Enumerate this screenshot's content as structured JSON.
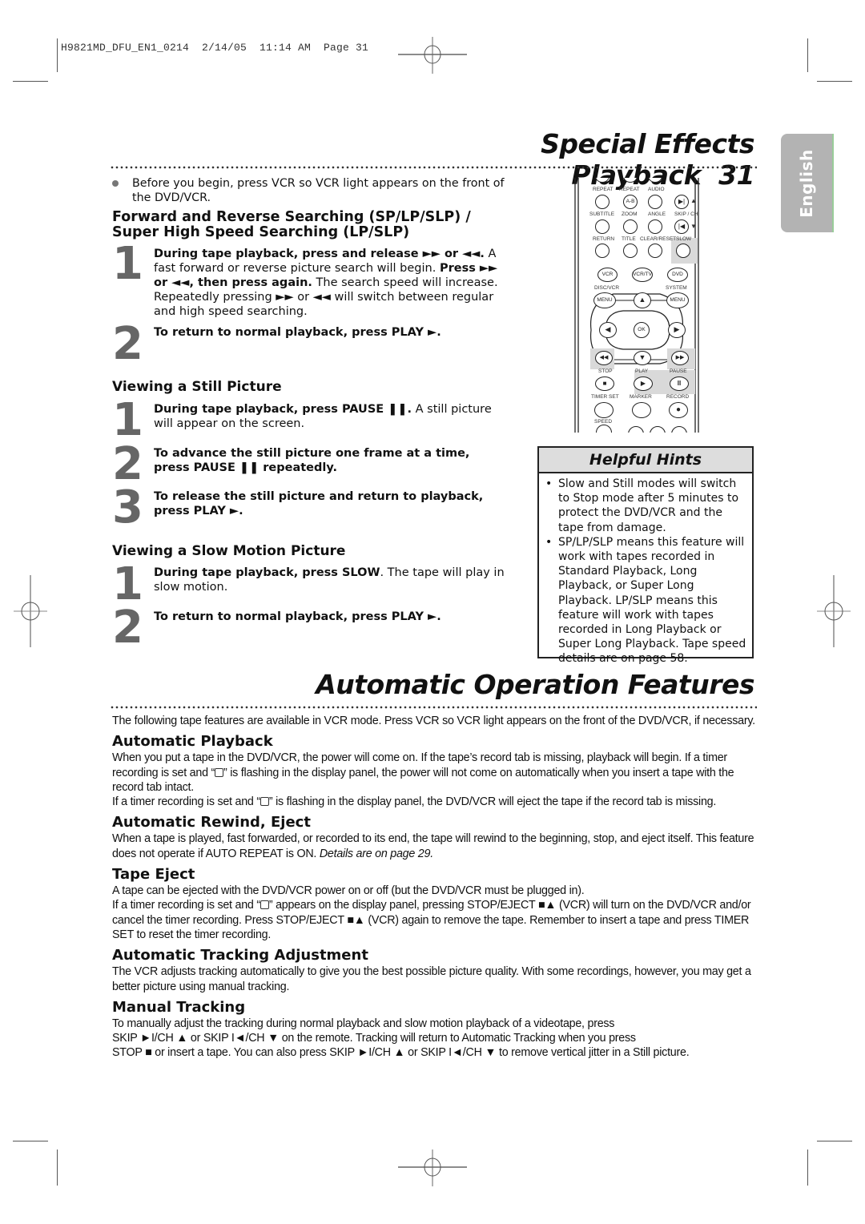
{
  "slug": "H9821MD_DFU_EN1_0214  2/14/05  11:14 AM  Page 31",
  "language_tab": "English",
  "page1": {
    "title": "Special Effects Playback",
    "page_number": "31",
    "intro_bullet": "Before you begin, press VCR so VCR light appears on the front of the DVD/VCR.",
    "section1": {
      "heading_line1": "Forward and Reverse Searching (SP/LP/SLP) /",
      "heading_line2": "Super High Speed Searching (LP/SLP)",
      "steps": [
        {
          "num": "1",
          "bold1": "During tape playback, press and release ►► or ◄◄.",
          "text1": " A fast forward or reverse picture search will begin. ",
          "bold2": "Press ►► or ◄◄, then press again.",
          "text2": " The search speed will increase. Repeatedly pressing ►► or ◄◄ will switch between regular and high speed searching."
        },
        {
          "num": "2",
          "bold1": "To return to normal playback, press PLAY ►."
        }
      ]
    },
    "section2": {
      "heading": "Viewing a Still Picture",
      "steps": [
        {
          "num": "1",
          "bold1": "During tape playback, press PAUSE ❚❚.",
          "text1": " A still picture will appear on the screen."
        },
        {
          "num": "2",
          "bold1": "To advance the still picture one frame at a time, press PAUSE ❚❚ repeatedly."
        },
        {
          "num": "3",
          "bold1": "To release the still picture and return to playback, press PLAY ►."
        }
      ]
    },
    "section3": {
      "heading": "Viewing a Slow Motion Picture",
      "steps": [
        {
          "num": "1",
          "bold1": "During tape playback, press SLOW",
          "text1": ". The tape will play in slow motion."
        },
        {
          "num": "2",
          "bold1": "To return to normal playback, press PLAY ►."
        }
      ]
    },
    "helpful_hints": {
      "title": "Helpful Hints",
      "items": [
        "Slow and Still modes will switch to Stop mode after 5 minutes to protect the DVD/VCR and the tape from damage.",
        "SP/LP/SLP means this feature will work with tapes recorded in Standard Playback, Long Playback, or Super Long Playback. LP/SLP means this feature will work with tapes recorded in Long Playback or Super Long Playback. Tape speed details are on page 58."
      ]
    },
    "remote": {
      "labels": {
        "repeat": "REPEAT",
        "repeat2": "REPEAT",
        "audio": "AUDIO",
        "ab": "A-B",
        "subtitle": "SUBTITLE",
        "zoom": "ZOOM",
        "angle": "ANGLE",
        "skipch": "SKIP / CH",
        "return": "RETURN",
        "title": "TITLE",
        "clear": "CLEAR/RESET",
        "slow": "SLOW",
        "vcr": "VCR",
        "vcrtv": "VCR/TV",
        "dvd": "DVD",
        "discvcr": "DISC/VCR",
        "system": "SYSTEM",
        "menu1": "MENU",
        "menu2": "MENU",
        "ok": "OK",
        "stop": "STOP",
        "play": "PLAY",
        "pause": "PAUSE",
        "timerset": "TIMER SET",
        "marker": "MARKER",
        "record": "RECORD",
        "speed": "SPEED"
      }
    }
  },
  "page2": {
    "title": "Automatic Operation Features",
    "intro": "The following tape features are available in VCR mode. Press VCR so VCR light appears on the front of the DVD/VCR, if necessary.",
    "sections": [
      {
        "heading": "Automatic Playback",
        "paragraphs": [
          "When you put a tape in the DVD/VCR, the power will come on. If the tape’s record tab is missing, playback will begin. If a timer recording is set and “[timer]” is flashing in the display panel, the power will not come on automatically when you insert a tape with the record tab intact.",
          "If a timer recording is set and “[timer]” is flashing in the display panel, the DVD/VCR will eject the tape if the record tab is missing."
        ]
      },
      {
        "heading": "Automatic Rewind, Eject",
        "paragraphs": [
          "When a tape is played, fast forwarded, or recorded to its end, the tape will rewind to the beginning, stop, and eject itself. This feature does not operate if AUTO REPEAT is ON."
        ],
        "italic_tail": " Details are on page 29."
      },
      {
        "heading": "Tape Eject",
        "paragraphs": [
          "A tape can be ejected with the DVD/VCR power on or off (but the DVD/VCR must be plugged in).",
          "If a timer recording is set and “[timer]” appears on the display panel, pressing STOP/EJECT ■▲ (VCR) will turn on the DVD/VCR and/or cancel the timer recording. Press STOP/EJECT ■▲ (VCR) again to remove the tape. Remember to insert a tape and press TIMER SET to reset the timer recording."
        ]
      },
      {
        "heading": "Automatic Tracking Adjustment",
        "paragraphs": [
          "The VCR adjusts tracking automatically to give you the best possible picture quality. With some recordings, however, you may get a better picture using manual tracking."
        ]
      },
      {
        "heading": "Manual Tracking",
        "paragraphs": [
          "To manually adjust the tracking during normal playback and slow motion playback of a videotape, press",
          "SKIP ►I/CH ▲ or SKIP I◄/CH ▼ on the remote. Tracking will return to Automatic Tracking when you press",
          "STOP ■ or insert a tape. You can also press SKIP ►I/CH ▲ or SKIP I◄/CH ▼ to remove vertical jitter in a Still picture."
        ]
      }
    ]
  }
}
